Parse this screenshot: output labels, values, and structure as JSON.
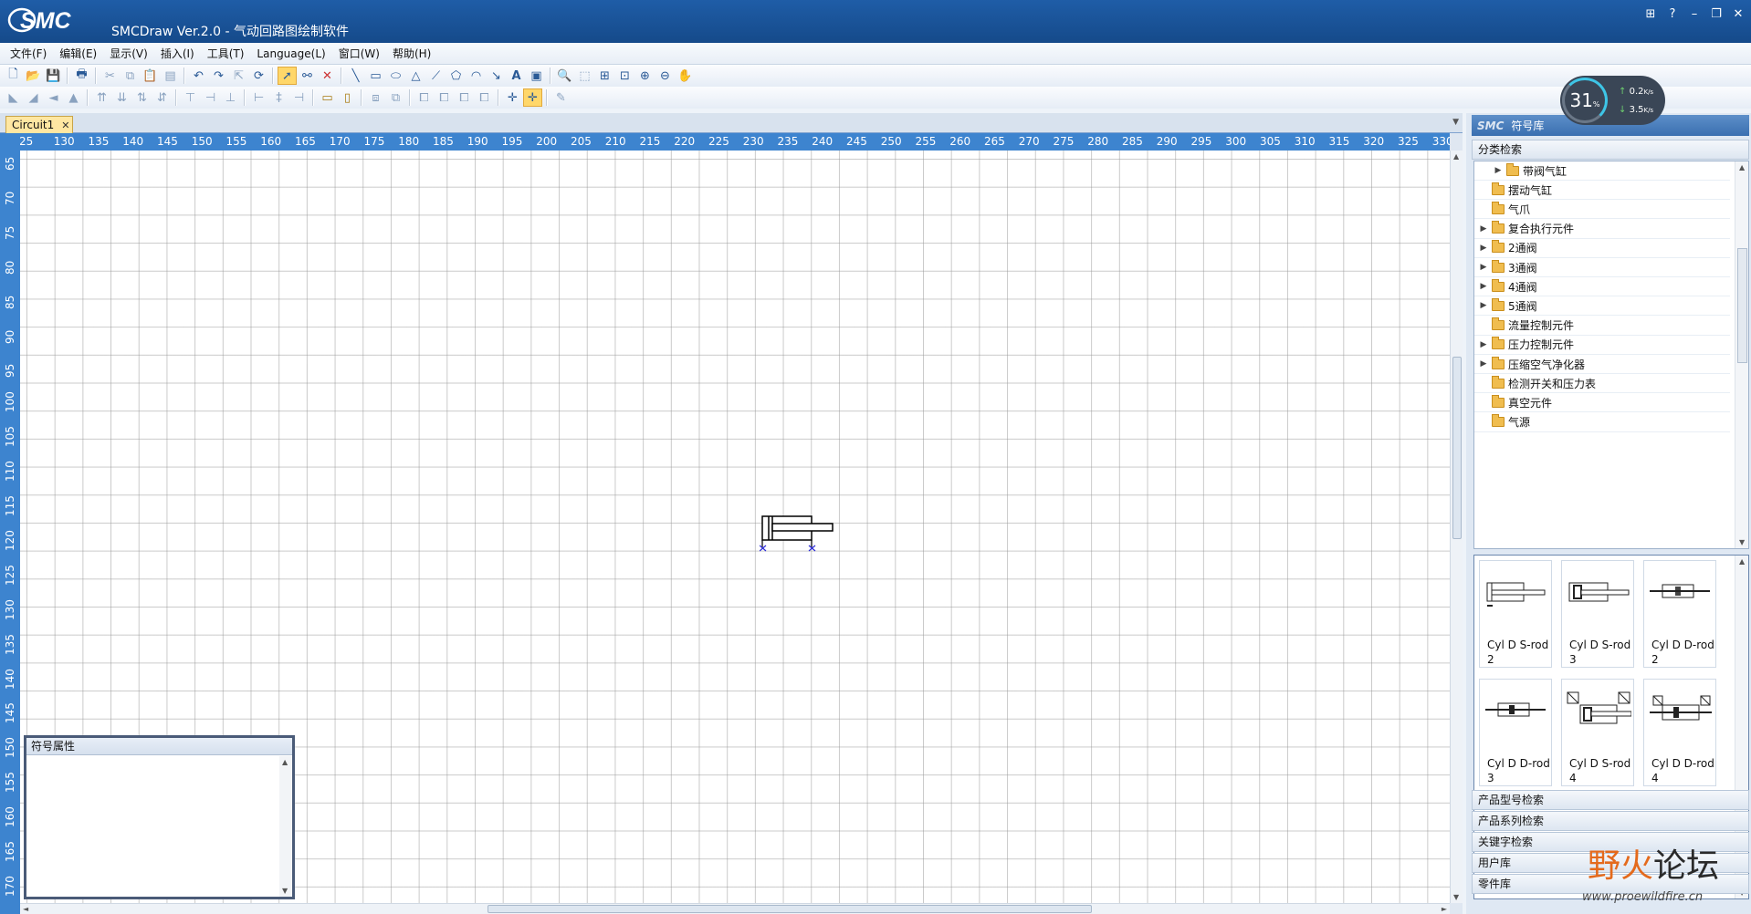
{
  "window": {
    "logo": "SMC",
    "title": "SMCDraw Ver.2.0 - 气动回路图绘制软件",
    "controls": [
      "⊞",
      "?",
      "–",
      "❐",
      "✕"
    ]
  },
  "menu": [
    "文件(F)",
    "编辑(E)",
    "显示(V)",
    "插入(I)",
    "工具(T)",
    "Language(L)",
    "窗口(W)",
    "帮助(H)"
  ],
  "toolbar1": [
    "new-icon",
    "open-icon",
    "save-icon",
    "print-icon",
    "cut-icon",
    "copy-icon",
    "paste-icon",
    "paste-special-icon",
    "undo-icon",
    "redo-icon",
    "export-icon",
    "refresh-icon",
    "pointer-icon",
    "connect-icon",
    "delete-icon",
    "line-icon",
    "rectangle-icon",
    "ellipse-icon",
    "triangle-icon",
    "polyline-icon",
    "polygon-icon",
    "arc-icon",
    "arrow-icon",
    "text-icon",
    "image-icon",
    "zoom-icon",
    "zoom-window-icon",
    "zoom-fit-icon",
    "zoom-page-icon",
    "zoom-in-icon",
    "zoom-out-icon",
    "pan-hand-icon"
  ],
  "document": {
    "tab": "Circuit1",
    "ruler_h": [
      "25",
      "130",
      "135",
      "140",
      "145",
      "150",
      "155",
      "160",
      "165",
      "170",
      "175",
      "180",
      "185",
      "190",
      "195",
      "200",
      "205",
      "210",
      "215",
      "220",
      "225",
      "230",
      "235",
      "240",
      "245",
      "250",
      "255",
      "260",
      "265",
      "270",
      "275",
      "280",
      "285",
      "290",
      "295",
      "300",
      "305",
      "310",
      "315",
      "320",
      "325",
      "330"
    ],
    "ruler_v": [
      "65",
      "70",
      "75",
      "80",
      "85",
      "90",
      "95",
      "100",
      "105",
      "110",
      "115",
      "120",
      "125",
      "130",
      "135",
      "140",
      "145",
      "150",
      "155",
      "160",
      "165",
      "170"
    ]
  },
  "properties_panel": {
    "title": "符号属性"
  },
  "right_panel": {
    "title": "符号库",
    "search_category": "分类检索",
    "tree": [
      {
        "label": "带阀气缸",
        "expandable": true,
        "indent": 1
      },
      {
        "label": "摆动气缸",
        "expandable": false,
        "indent": 0
      },
      {
        "label": "气爪",
        "expandable": false,
        "indent": 0
      },
      {
        "label": "复合执行元件",
        "expandable": true,
        "indent": 0
      },
      {
        "label": "2通阀",
        "expandable": true,
        "indent": 0
      },
      {
        "label": "3通阀",
        "expandable": true,
        "indent": 0
      },
      {
        "label": "4通阀",
        "expandable": true,
        "indent": 0
      },
      {
        "label": "5通阀",
        "expandable": true,
        "indent": 0
      },
      {
        "label": "流量控制元件",
        "expandable": false,
        "indent": 0
      },
      {
        "label": "压力控制元件",
        "expandable": true,
        "indent": 0
      },
      {
        "label": "压缩空气净化器",
        "expandable": true,
        "indent": 0
      },
      {
        "label": "检测开关和压力表",
        "expandable": false,
        "indent": 0
      },
      {
        "label": "真空元件",
        "expandable": false,
        "indent": 0
      },
      {
        "label": "气源",
        "expandable": false,
        "indent": 0
      }
    ],
    "gallery": [
      {
        "line1": "Cyl D S-rod",
        "line2": "2"
      },
      {
        "line1": "Cyl D S-rod",
        "line2": "3"
      },
      {
        "line1": "Cyl D D-rod",
        "line2": "2"
      },
      {
        "line1": "Cyl D D-rod",
        "line2": "3"
      },
      {
        "line1": "Cyl D S-rod",
        "line2": "4"
      },
      {
        "line1": "Cyl D D-rod",
        "line2": "4"
      }
    ],
    "bottom_sections": [
      "产品型号检索",
      "产品系列检索",
      "关键字检索",
      "用户库",
      "零件库"
    ]
  },
  "speed_widget": {
    "percent": "31",
    "pct_sign": "%",
    "up": "0.2",
    "down": "3.5",
    "unit": "K/s"
  },
  "watermark": {
    "text_a": "野",
    "text_b": "火",
    "text_c": "论坛",
    "url": "www.proewildfire.cn"
  }
}
